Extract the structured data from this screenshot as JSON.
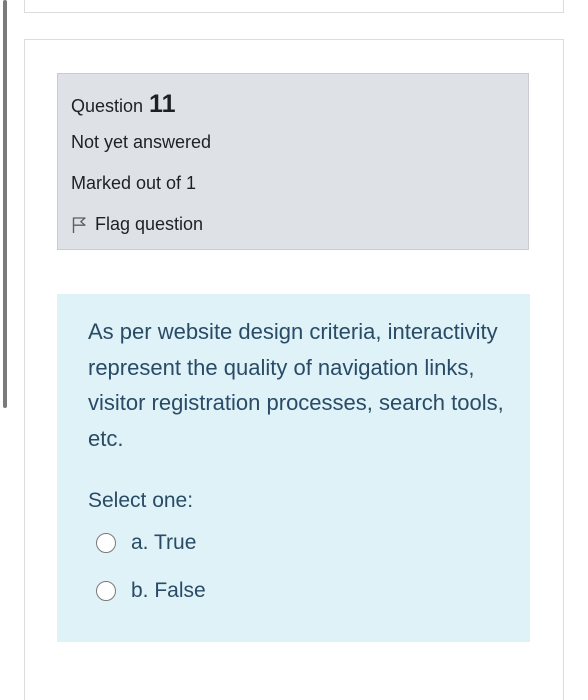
{
  "question_info": {
    "label": "Question",
    "number": "11",
    "state": "Not yet answered",
    "grade": "Marked out of 1",
    "flag_label": "Flag question"
  },
  "question_content": {
    "text": "As per website design criteria, interactivity represent the quality of navigation links, visitor registration processes, search tools, etc.",
    "prompt": "Select one:",
    "options": [
      {
        "label": "a. True",
        "selected": false
      },
      {
        "label": "b. False",
        "selected": false
      }
    ]
  },
  "colors": {
    "info_bg": "#dee2e6",
    "content_bg": "#def2f8",
    "content_text": "#2a4b66"
  },
  "icons": {
    "flag": "flag-outline-icon",
    "radio": "radio-empty-icon"
  }
}
